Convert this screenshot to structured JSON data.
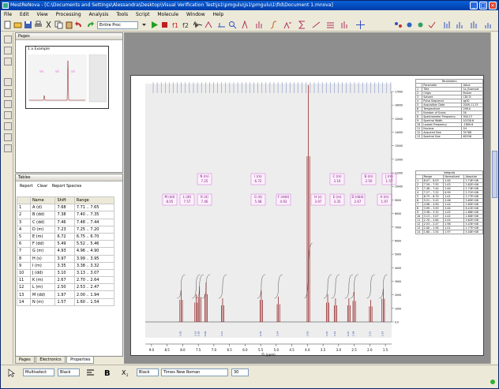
{
  "app": {
    "title": "MestReNova - [C:\\Documents and Settings\\Alessandra\\Desktop\\Visual Verification Test\\js1\\pmgulu\\js1\\pmgulu\\1\\fid\\Document 1.mnova]",
    "window_buttons": [
      "_",
      "□",
      "×"
    ]
  },
  "menu": [
    "File",
    "Edit",
    "View",
    "Processing",
    "Analysis",
    "Tools",
    "Script",
    "Molecule",
    "Window",
    "Help"
  ],
  "toolbar": {
    "combo_value": "Entire Proc"
  },
  "pages_panel": {
    "title": "Pages",
    "thumb_label": "1 a Example"
  },
  "tables_panel": {
    "title": "Tables",
    "buttons": [
      "Report",
      "Clear",
      "Report Species"
    ],
    "columns": [
      "",
      "Name",
      "Shift",
      "Range"
    ],
    "rows": [
      [
        "1",
        "A (d)",
        "7.68",
        "7.71 .. 7.65"
      ],
      [
        "2",
        "B (dd)",
        "7.38",
        "7.40 .. 7.35"
      ],
      [
        "3",
        "C (dd)",
        "7.46",
        "7.48 .. 7.44"
      ],
      [
        "4",
        "D (m)",
        "7.23",
        "7.25 .. 7.20"
      ],
      [
        "5",
        "E (m)",
        "6.72",
        "6.75 .. 6.70"
      ],
      [
        "6",
        "F (dd)",
        "5.49",
        "5.52 .. 5.46"
      ],
      [
        "7",
        "G (m)",
        "4.93",
        "4.96 .. 4.90"
      ],
      [
        "8",
        "H (s)",
        "3.97",
        "3.99 .. 3.95"
      ],
      [
        "9",
        "I (m)",
        "3.35",
        "3.38 .. 3.32"
      ],
      [
        "10",
        "J (dd)",
        "3.10",
        "3.13 .. 3.07"
      ],
      [
        "11",
        "K (m)",
        "2.67",
        "2.70 .. 2.64"
      ],
      [
        "12",
        "L (m)",
        "2.50",
        "2.53 .. 2.47"
      ],
      [
        "13",
        "M (dd)",
        "1.97",
        "2.00 .. 1.94"
      ],
      [
        "14",
        "N (m)",
        "1.57",
        "1.60 .. 1.54"
      ]
    ]
  },
  "left_tabs": [
    "Pages",
    "Electronics",
    "Properties"
  ],
  "spectrum": {
    "axis_title": "f1 (ppm)",
    "x_ticks": [
      "9.0",
      "8.5",
      "8.0",
      "7.5",
      "7.0",
      "6.5",
      "6.0",
      "5.5",
      "5.0",
      "4.5",
      "4.0",
      "3.5",
      "3.0",
      "2.5",
      "2.0",
      "1.5"
    ],
    "right_ticks": [
      "0.0",
      "1000",
      "2000",
      "3000",
      "4000",
      "5000",
      "6000",
      "7000",
      "8000",
      "9000",
      "10000",
      "11000",
      "12000",
      "13000",
      "14000",
      "15000",
      "16000",
      "17000"
    ],
    "multiplets": [
      {
        "name": "M (dd)",
        "shift": "8.05"
      },
      {
        "name": "L (dt)",
        "shift": "7.57"
      },
      {
        "name": "K (d)",
        "shift": "7.46"
      },
      {
        "name": "N (m)",
        "shift": "7.25"
      },
      {
        "name": "I (m)",
        "shift": "6.72"
      },
      {
        "name": "G (d)",
        "shift": "5.48"
      },
      {
        "name": "F (ddd)",
        "shift": "4.93"
      },
      {
        "name": "H (s)",
        "shift": "3.97"
      },
      {
        "name": "E (m)",
        "shift": "3.35"
      },
      {
        "name": "C (m)",
        "shift": "3.10"
      },
      {
        "name": "D (ddd)",
        "shift": "2.67"
      },
      {
        "name": "B (m)",
        "shift": "2.50"
      },
      {
        "name": "A (m)",
        "shift": "1.97"
      },
      {
        "name": "J (m)",
        "shift": "1.57"
      }
    ],
    "integrals": [
      "1.00",
      "1.03",
      "1.00",
      "0.99",
      "1.01",
      "2.06",
      "1.04",
      "3.00",
      "1.05",
      "1.02",
      "2.05",
      "1.98",
      "1.01",
      "1.97"
    ]
  },
  "parameters": {
    "title": "Parameters",
    "columns": [
      "",
      "Parameter",
      "Value"
    ],
    "rows": [
      [
        "1",
        "Title",
        "1a_Example"
      ],
      [
        "2",
        "Origin",
        "Bruker"
      ],
      [
        "3",
        "Solvent",
        "CDCl3"
      ],
      [
        "4",
        "Pulse Sequence",
        "zg30"
      ],
      [
        "5",
        "Acquisition Date",
        "2009-11-25"
      ],
      [
        "6",
        "Temperature",
        "298.0"
      ],
      [
        "7",
        "Number of Scans",
        "16"
      ],
      [
        "8",
        "Spectrometer Frequency",
        "500.13"
      ],
      [
        "9",
        "Spectral Width",
        "10330.6"
      ],
      [
        "10",
        "Lowest Frequency",
        "-1809.6"
      ],
      [
        "11",
        "Nucleus",
        "1H"
      ],
      [
        "12",
        "Acquired Size",
        "32768"
      ],
      [
        "13",
        "Spectral Size",
        "65536"
      ]
    ]
  },
  "integrals_table": {
    "title": "Integrals",
    "columns": [
      "",
      "Range",
      "Normalized",
      "Absolute"
    ],
    "rows": [
      [
        "1",
        "8.07 .. 8.03",
        "1.00",
        "2.74E+08"
      ],
      [
        "2",
        "7.59 .. 7.55",
        "1.03",
        "2.82E+08"
      ],
      [
        "3",
        "7.48 .. 7.44",
        "1.00",
        "2.74E+08"
      ],
      [
        "4",
        "7.27 .. 7.22",
        "0.99",
        "2.71E+08"
      ],
      [
        "5",
        "6.75 .. 6.70",
        "1.01",
        "2.77E+08"
      ],
      [
        "6",
        "5.51 .. 5.45",
        "2.06",
        "5.65E+08"
      ],
      [
        "7",
        "4.96 .. 4.90",
        "1.04",
        "2.85E+08"
      ],
      [
        "8",
        "3.99 .. 3.95",
        "3.00",
        "8.22E+08"
      ],
      [
        "9",
        "3.38 .. 3.32",
        "1.05",
        "2.88E+08"
      ],
      [
        "10",
        "3.13 .. 3.07",
        "1.02",
        "2.80E+08"
      ],
      [
        "11",
        "2.70 .. 2.64",
        "2.05",
        "5.62E+08"
      ],
      [
        "12",
        "2.53 .. 2.47",
        "1.98",
        "5.43E+08"
      ],
      [
        "13",
        "2.00 .. 1.94",
        "1.01",
        "2.77E+08"
      ],
      [
        "14",
        "1.60 .. 1.54",
        "1.97",
        "5.40E+08"
      ]
    ]
  },
  "statusbar": {
    "combo_a": "Multiselect",
    "combo_b": "Black",
    "combo_c": "Black",
    "font": "Times New Roman",
    "size": "30"
  },
  "colors": {
    "spectrum": "#8b1010",
    "integral": "#2a2a2a",
    "label_border": "#d070d8",
    "titlebar": "#0a5fd8"
  }
}
